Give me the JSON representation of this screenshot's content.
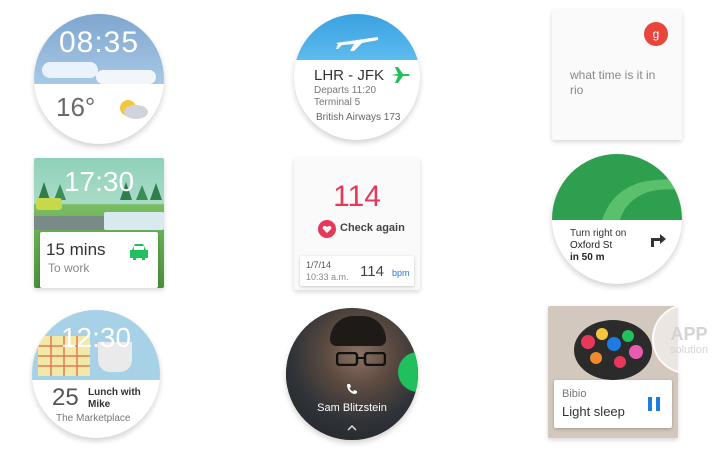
{
  "watch_clock": {
    "time": "08:35",
    "temp": "16°",
    "weather_icon": "partly-cloudy-icon"
  },
  "watch_flight": {
    "route": "LHR - JFK",
    "departs": "Departs 11:20",
    "terminal": "Terminal 5",
    "airline": "British Airways 173",
    "icon": "airplane-icon"
  },
  "watch_voice": {
    "prompt": "what time is it in rio",
    "badge": "g"
  },
  "watch_commute": {
    "time": "17:30",
    "duration": "15 mins",
    "destination": "To work",
    "icon": "car-icon"
  },
  "watch_heart": {
    "bpm_big": "114",
    "action": "Check again",
    "date": "1/7/14",
    "clock": "10:33 a.m.",
    "bpm": "114",
    "unit": "bpm"
  },
  "watch_nav": {
    "instruction": "Turn right on",
    "street": "Oxford St",
    "distance": "in 50 m",
    "icon": "turn-right-icon"
  },
  "watch_event": {
    "time": "12:30",
    "day": "25",
    "title": "Lunch with",
    "title2": "Mike",
    "place": "The Marketplace"
  },
  "watch_call": {
    "name": "Sam Blitzstein",
    "icon": "phone-icon"
  },
  "watch_music": {
    "artist": "Bibio",
    "track": "Light sleep",
    "icon": "pause-icon"
  },
  "watermark": {
    "line1": "APP",
    "line2": "solution"
  },
  "colors": {
    "green": "#20c05c",
    "red": "#e8385a",
    "blue": "#1e7be0",
    "sky": "#4ab0e6"
  }
}
